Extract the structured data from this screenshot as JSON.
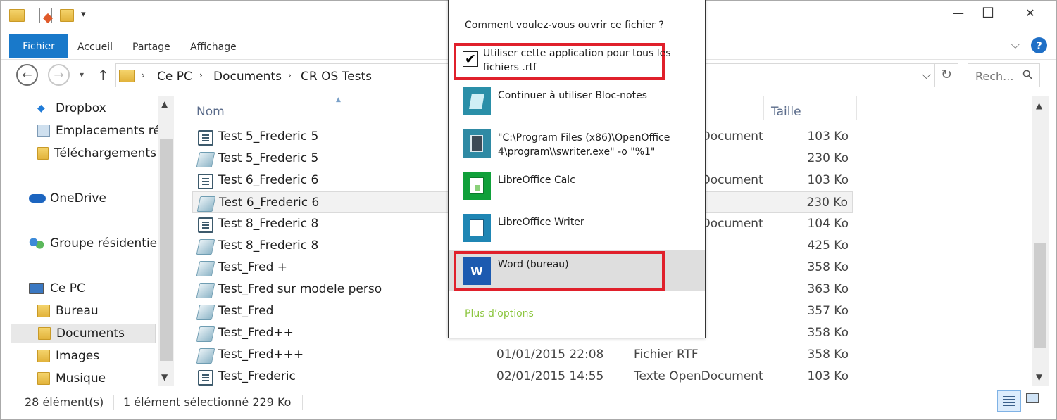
{
  "title_bar": {
    "minimize_glyph": "—",
    "maximize_glyph": "☐",
    "close_glyph": "✕",
    "qat_dropdown_glyph": "▾"
  },
  "ribbon": {
    "tabs": [
      "Fichier",
      "Accueil",
      "Partage",
      "Affichage"
    ],
    "expand_glyph": "⌵",
    "help_glyph": "?"
  },
  "address_bar": {
    "back_glyph": "←",
    "forward_glyph": "→",
    "recent_glyph": "▾",
    "up_glyph": "↑",
    "breadcrumbs": [
      "Ce PC",
      "Documents",
      "CR OS Tests"
    ],
    "separator_glyph": "›",
    "dropdown_glyph": "⌵",
    "refresh_glyph": "↻",
    "search_placeholder": "Rech...",
    "search_glyph": "⚲"
  },
  "nav_pane": {
    "items": [
      {
        "label": "Dropbox",
        "icon": "dropbox-icon"
      },
      {
        "label": "Emplacements réc",
        "icon": "recent-places-icon"
      },
      {
        "label": "Téléchargements",
        "icon": "downloads-folder-icon"
      },
      {
        "label": "OneDrive",
        "icon": "onedrive-icon"
      },
      {
        "label": "Groupe résidentiel",
        "icon": "homegroup-icon"
      },
      {
        "label": "Ce PC",
        "icon": "computer-icon"
      },
      {
        "label": "Bureau",
        "icon": "desktop-folder-icon"
      },
      {
        "label": "Documents",
        "icon": "documents-folder-icon",
        "selected": true
      },
      {
        "label": "Images",
        "icon": "pictures-folder-icon"
      },
      {
        "label": "Musique",
        "icon": "music-folder-icon"
      }
    ]
  },
  "file_list": {
    "headers": {
      "name": "Nom",
      "size": "Taille"
    },
    "rows": [
      {
        "name": "Test 5_Frederic 5",
        "date": "",
        "type": "Texte OpenDocument",
        "size": "103 Ko",
        "icon": "odt"
      },
      {
        "name": "Test 5_Frederic 5",
        "date": "",
        "type": "",
        "size": "230 Ko",
        "icon": "rtf"
      },
      {
        "name": "Test 6_Frederic 6",
        "date": "",
        "type": "Texte OpenDocument",
        "size": "103 Ko",
        "icon": "odt"
      },
      {
        "name": "Test 6_Frederic 6",
        "date": "",
        "type": "",
        "size": "230 Ko",
        "icon": "rtf",
        "selected": true
      },
      {
        "name": "Test 8_Frederic 8",
        "date": "",
        "type": "Texte OpenDocument",
        "size": "104 Ko",
        "icon": "odt"
      },
      {
        "name": "Test 8_Frederic 8",
        "date": "",
        "type": "",
        "size": "425 Ko",
        "icon": "rtf"
      },
      {
        "name": "Test_Fred +",
        "date": "",
        "type": "",
        "size": "358 Ko",
        "icon": "rtf"
      },
      {
        "name": "Test_Fred sur modele perso",
        "date": "",
        "type": "",
        "size": "363 Ko",
        "icon": "rtf"
      },
      {
        "name": "Test_Fred",
        "date": "",
        "type": "",
        "size": "357 Ko",
        "icon": "rtf"
      },
      {
        "name": "Test_Fred++",
        "date": "",
        "type": "",
        "size": "358 Ko",
        "icon": "rtf"
      },
      {
        "name": "Test_Fred+++",
        "date": "01/01/2015 22:08",
        "type": "Fichier RTF",
        "size": "358 Ko",
        "icon": "rtf"
      },
      {
        "name": "Test_Frederic",
        "date": "02/01/2015 14:55",
        "type": "Texte OpenDocument",
        "size": "103 Ko",
        "icon": "odt"
      }
    ]
  },
  "status_bar": {
    "count": "28 élément(s)",
    "selection": "1 élément sélectionné  229 Ko"
  },
  "open_with_dialog": {
    "question": "Comment voulez-vous ouvrir ce fichier ?",
    "always_use_line1": "Utiliser cette application pour tous les",
    "always_use_line2": "fichiers .rtf",
    "always_use_checked": true,
    "apps": [
      {
        "line1": "Continuer à utiliser Bloc-notes",
        "line2": "",
        "icon": "notepad-icon"
      },
      {
        "line1": "\"C:\\Program Files (x86)\\OpenOffice",
        "line2": "4\\program\\\\swriter.exe\" -o \"%1\"",
        "icon": "openoffice-writer-icon"
      },
      {
        "line1": "LibreOffice Calc",
        "line2": "",
        "icon": "libreoffice-calc-icon"
      },
      {
        "line1": "LibreOffice Writer",
        "line2": "",
        "icon": "libreoffice-writer-icon"
      },
      {
        "line1": "Word (bureau)",
        "line2": "",
        "icon": "word-icon",
        "highlighted": true
      }
    ],
    "more_options": "Plus d’options",
    "more_options_color": "#8cc63f",
    "highlight_color": "#e0202b"
  }
}
